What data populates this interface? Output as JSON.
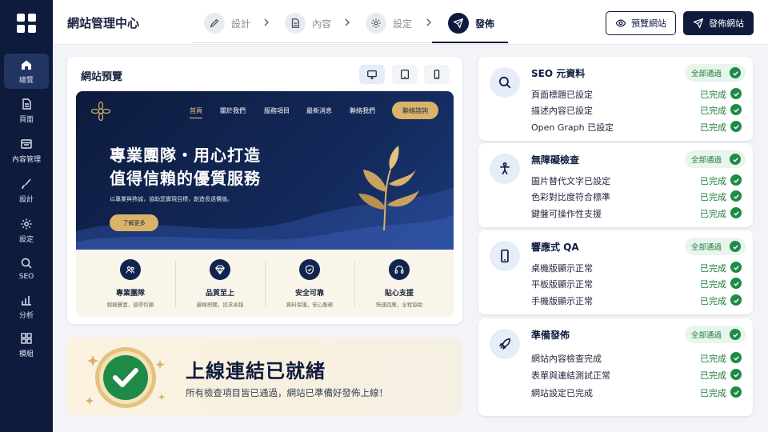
{
  "sidebar": {
    "items": [
      {
        "label": "總覽",
        "icon": "home-icon"
      },
      {
        "label": "頁面",
        "icon": "page-icon"
      },
      {
        "label": "內容管理",
        "icon": "content-icon"
      },
      {
        "label": "設計",
        "icon": "brush-icon"
      },
      {
        "label": "設定",
        "icon": "gear-icon"
      },
      {
        "label": "SEO",
        "icon": "search-icon"
      },
      {
        "label": "分析",
        "icon": "chart-icon"
      },
      {
        "label": "模組",
        "icon": "grid-icon"
      }
    ]
  },
  "header": {
    "title": "網站管理中心",
    "steps": [
      {
        "label": "設計",
        "icon": "pencil-icon"
      },
      {
        "label": "內容",
        "icon": "document-icon"
      },
      {
        "label": "設定",
        "icon": "gear-icon"
      },
      {
        "label": "發佈",
        "icon": "rocket-icon"
      }
    ],
    "preview_button": "預覽網站",
    "publish_button": "發佈網站"
  },
  "preview": {
    "title": "網站預覽",
    "devices": [
      "desktop-icon",
      "tablet-icon",
      "mobile-icon"
    ],
    "site": {
      "nav": [
        "首頁",
        "關於我們",
        "服務項目",
        "最新消息",
        "聯絡我們"
      ],
      "cta": "聯絡諮詢",
      "hero_line1": "專業團隊・用心打造",
      "hero_line2": "值得信賴的優質服務",
      "hero_sub": "以專業與熱誠，協助您實現目標，創造長遠價值。",
      "hero_button": "了解更多",
      "features": [
        {
          "title": "專業團隊",
          "sub": "經驗豐富，值得信賴",
          "icon": "team-icon"
        },
        {
          "title": "品質至上",
          "sub": "嚴格把關，追求卓越",
          "icon": "diamond-icon"
        },
        {
          "title": "安全可靠",
          "sub": "資料保護，安心服務",
          "icon": "shield-icon"
        },
        {
          "title": "貼心支援",
          "sub": "快速回應，全程協助",
          "icon": "headset-icon"
        }
      ]
    }
  },
  "banner": {
    "title": "上線連結已就緒",
    "text": "所有檢查項目皆已通過，網站已準備好發佈上線！"
  },
  "checks": [
    {
      "title": "SEO 元資料",
      "badge": "全部通過",
      "icon": "search-icon",
      "items": [
        {
          "label": "頁面標題已設定",
          "status": "已完成"
        },
        {
          "label": "描述內容已設定",
          "status": "已完成"
        },
        {
          "label": "Open Graph 已設定",
          "status": "已完成"
        }
      ]
    },
    {
      "title": "無障礙檢查",
      "badge": "全部通過",
      "icon": "accessibility-icon",
      "items": [
        {
          "label": "圖片替代文字已設定",
          "status": "已完成"
        },
        {
          "label": "色彩對比度符合標準",
          "status": "已完成"
        },
        {
          "label": "鍵盤可操作性支援",
          "status": "已完成"
        }
      ]
    },
    {
      "title": "響應式 QA",
      "badge": "全部通過",
      "icon": "mobile-icon",
      "items": [
        {
          "label": "桌機版顯示正常",
          "status": "已完成"
        },
        {
          "label": "平板版顯示正常",
          "status": "已完成"
        },
        {
          "label": "手機版顯示正常",
          "status": "已完成"
        }
      ]
    },
    {
      "title": "準備發佈",
      "badge": "全部通過",
      "icon": "rocket-icon",
      "items": [
        {
          "label": "網站內容檢查完成",
          "status": "已完成"
        },
        {
          "label": "表單與連結測試正常",
          "status": "已完成"
        },
        {
          "label": "網站設定已完成",
          "status": "已完成"
        }
      ]
    }
  ],
  "colors": {
    "navy": "#0e1b3d",
    "gold": "#d9b36a",
    "success": "#1e8a47"
  }
}
